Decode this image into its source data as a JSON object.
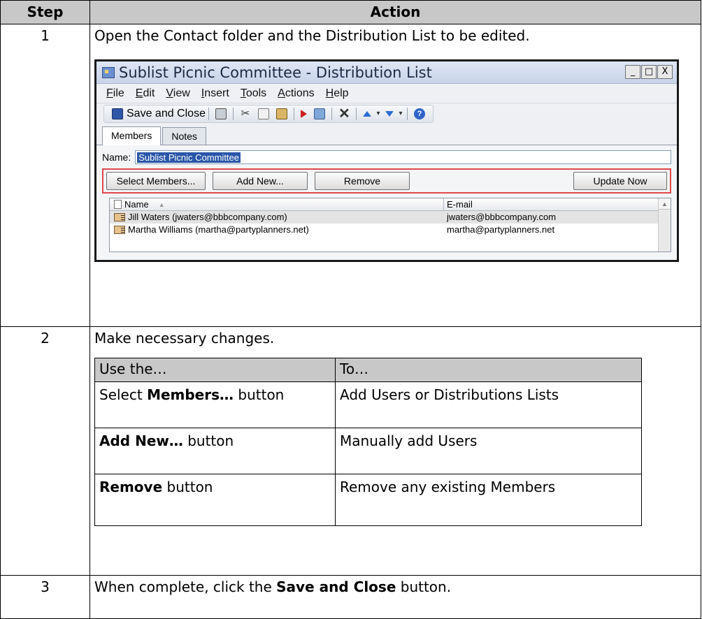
{
  "header": {
    "step": "Step",
    "action": "Action"
  },
  "steps": [
    {
      "number": "1",
      "text": "Open the Contact folder and the Distribution List to be edited."
    },
    {
      "number": "2",
      "text": "Make necessary changes."
    },
    {
      "number": "3",
      "text_before": "When complete, click the ",
      "bold": "Save and Close",
      "text_after": " button."
    }
  ],
  "window": {
    "title": "Sublist Picnic Committee - Distribution List",
    "controls": {
      "minimize": "_",
      "maximize": "□",
      "close": "X"
    },
    "menu": [
      "File",
      "Edit",
      "View",
      "Insert",
      "Tools",
      "Actions",
      "Help"
    ],
    "toolbar": {
      "save_label": "Save and Close"
    },
    "tabs": [
      "Members",
      "Notes"
    ],
    "name_label": "Name:",
    "name_value": "Sublist Picnic Committee",
    "buttons": {
      "select": "Select Members...",
      "add": "Add New...",
      "remove": "Remove",
      "update": "Update Now"
    },
    "list": {
      "columns": {
        "name": "Name",
        "email": "E-mail"
      },
      "rows": [
        {
          "name": "Jill Waters (jwaters@bbbcompany.com)",
          "email": "jwaters@bbbcompany.com"
        },
        {
          "name": "Martha Williams (martha@partyplanners.net)",
          "email": "martha@partyplanners.net"
        }
      ]
    }
  },
  "inner_table": {
    "headers": [
      "Use the…",
      "To…"
    ],
    "rows": [
      {
        "prefix": "Select ",
        "bold": "Members…",
        "suffix": " button",
        "to": "Add Users or Distributions Lists"
      },
      {
        "prefix": "",
        "bold": "Add New…",
        "suffix": " button",
        "to": "Manually add Users"
      },
      {
        "prefix": "",
        "bold": "Remove",
        "suffix": " button",
        "to": "Remove any existing Members"
      }
    ]
  }
}
